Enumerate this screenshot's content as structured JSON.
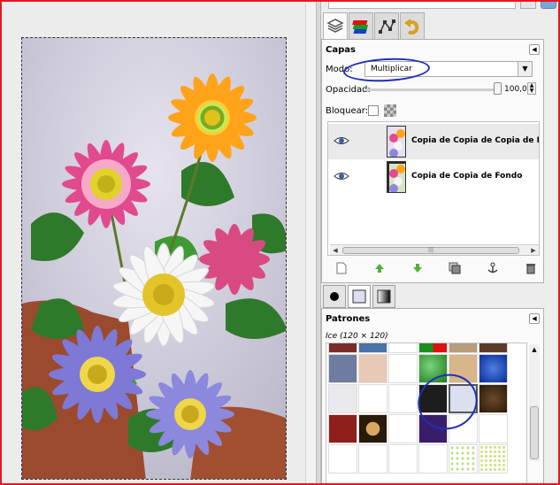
{
  "colors": {
    "accent_frame": "#e8161b",
    "annotation_circle": "#1e2fb8"
  },
  "tabs": [
    {
      "name": "layers-tab",
      "icon": "layers-icon"
    },
    {
      "name": "channels-tab",
      "icon": "channels-icon"
    },
    {
      "name": "paths-tab",
      "icon": "paths-icon"
    },
    {
      "name": "undo-tab",
      "icon": "undo-icon"
    }
  ],
  "layers": {
    "title": "Capas",
    "mode_label": "Modo:",
    "mode_value": "Multiplicar",
    "opacity_label": "Opacidad:",
    "opacity_value": "100,0",
    "opacity_fraction": 1.0,
    "lock_label": "Bloquear:",
    "items": [
      {
        "name": "Copia de Copia de Copia de Fondo",
        "visible": true,
        "selected": true
      },
      {
        "name": "Copia de Copia de Fondo",
        "visible": true,
        "selected": false
      }
    ],
    "actions": [
      "new-layer-icon",
      "raise-layer-icon",
      "lower-layer-icon",
      "duplicate-layer-icon",
      "anchor-layer-icon",
      "delete-layer-icon"
    ]
  },
  "patterns": {
    "title": "Patrones",
    "selected_info": "Ice (120 × 120)"
  }
}
